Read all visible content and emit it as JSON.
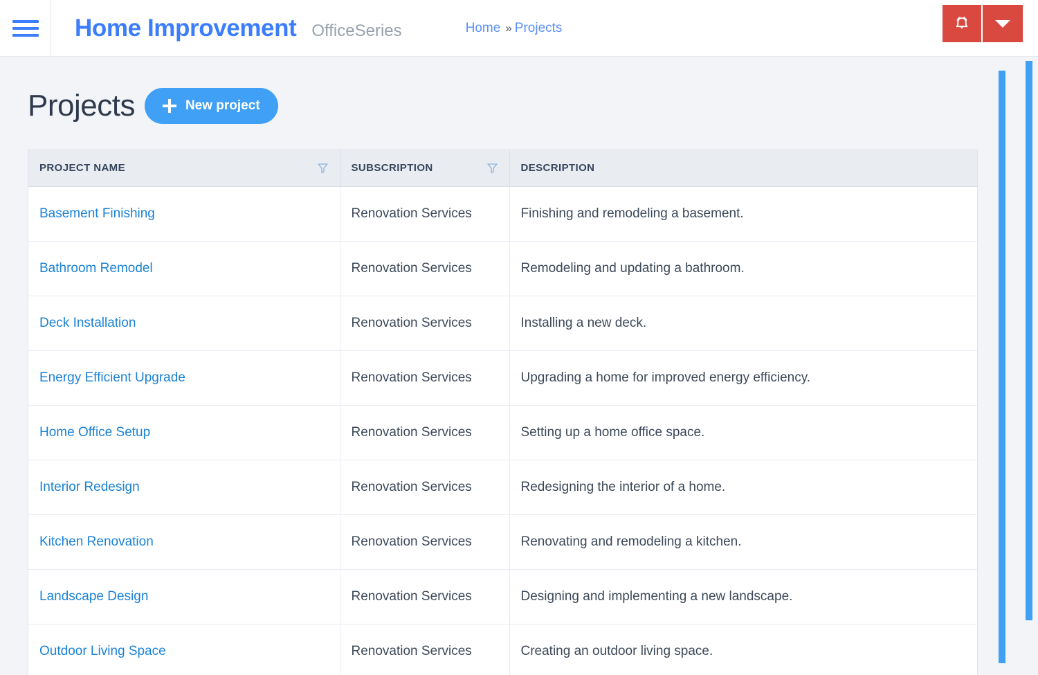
{
  "header": {
    "menu_icon": "hamburger-icon",
    "brand_title": "Home Improvement",
    "brand_subtitle": "OfficeSeries",
    "breadcrumb": {
      "items": [
        "Home",
        "Projects"
      ],
      "separator": "»"
    },
    "actions": {
      "alarm_icon": "alarm-bell-icon",
      "dropdown_icon": "caret-down-icon",
      "accent_color": "#d9493f"
    }
  },
  "page": {
    "title": "Projects",
    "new_button_label": "New project",
    "new_button_icon": "plus-icon",
    "accent_color": "#3fa0f6"
  },
  "table": {
    "columns": [
      {
        "label": "PROJECT NAME",
        "filterable": true,
        "filter_icon": "filter-funnel-icon"
      },
      {
        "label": "SUBSCRIPTION",
        "filterable": true,
        "filter_icon": "filter-funnel-icon"
      },
      {
        "label": "DESCRIPTION",
        "filterable": false
      }
    ],
    "rows": [
      {
        "name": "Basement Finishing",
        "subscription": "Renovation Services",
        "description": "Finishing and remodeling a basement."
      },
      {
        "name": "Bathroom Remodel",
        "subscription": "Renovation Services",
        "description": "Remodeling and updating a bathroom."
      },
      {
        "name": "Deck Installation",
        "subscription": "Renovation Services",
        "description": "Installing a new deck."
      },
      {
        "name": "Energy Efficient Upgrade",
        "subscription": "Renovation Services",
        "description": "Upgrading a home for improved energy efficiency."
      },
      {
        "name": "Home Office Setup",
        "subscription": "Renovation Services",
        "description": "Setting up a home office space."
      },
      {
        "name": "Interior Redesign",
        "subscription": "Renovation Services",
        "description": "Redesigning the interior of a home."
      },
      {
        "name": "Kitchen Renovation",
        "subscription": "Renovation Services",
        "description": "Renovating and remodeling a kitchen."
      },
      {
        "name": "Landscape Design",
        "subscription": "Renovation Services",
        "description": "Designing and implementing a new landscape."
      },
      {
        "name": "Outdoor Living Space",
        "subscription": "Renovation Services",
        "description": "Creating an outdoor living space."
      }
    ]
  },
  "scrollbars": {
    "inner": {
      "name": "content-scrollbar",
      "color": "#3fa0f6"
    },
    "outer": {
      "name": "window-scrollbar",
      "color": "#3fa0f6"
    }
  }
}
